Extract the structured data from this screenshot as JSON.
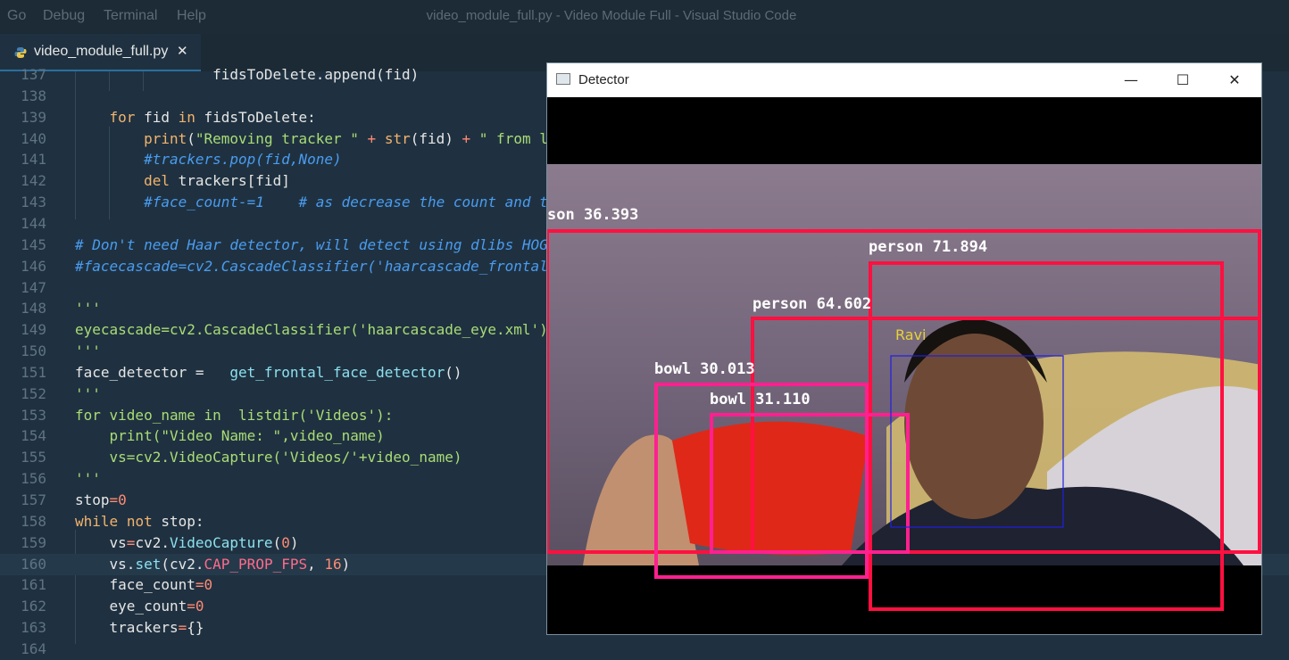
{
  "menu": [
    "Go",
    "Debug",
    "Terminal",
    "Help"
  ],
  "window_title": "video_module_full.py - Video Module Full - Visual Studio Code",
  "tab": {
    "label": "video_module_full.py",
    "close": "✕"
  },
  "code_lines": [
    {
      "n": "137",
      "t": [
        [
          "                fidsToDelete.append(fid)",
          "c-white"
        ]
      ]
    },
    {
      "n": "138",
      "t": []
    },
    {
      "n": "139",
      "t": [
        [
          "    ",
          "c-white"
        ],
        [
          "for",
          "c-kw"
        ],
        [
          " fid ",
          "c-white"
        ],
        [
          "in",
          "c-kw"
        ],
        [
          " fidsToDelete:",
          "c-white"
        ]
      ]
    },
    {
      "n": "140",
      "t": [
        [
          "        ",
          "c-white"
        ],
        [
          "print",
          "c-kw"
        ],
        [
          "(",
          "c-white"
        ],
        [
          "\"Removing tracker \"",
          "c-str"
        ],
        [
          " + ",
          "c-op"
        ],
        [
          "str",
          "c-kw"
        ],
        [
          "(fid) ",
          "c-white"
        ],
        [
          "+",
          "c-op"
        ],
        [
          " \" from l",
          "c-str"
        ]
      ]
    },
    {
      "n": "141",
      "t": [
        [
          "        #trackers.pop(fid,None)",
          "c-com"
        ]
      ]
    },
    {
      "n": "142",
      "t": [
        [
          "        ",
          "c-white"
        ],
        [
          "del",
          "c-kw"
        ],
        [
          " trackers[fid]",
          "c-white"
        ]
      ]
    },
    {
      "n": "143",
      "t": [
        [
          "        #face_count-=1    # as decrease the count and t",
          "c-com"
        ]
      ]
    },
    {
      "n": "144",
      "t": []
    },
    {
      "n": "145",
      "t": [
        [
          "# Don't need Haar detector, will detect using dlibs HOG",
          "c-com"
        ]
      ]
    },
    {
      "n": "146",
      "t": [
        [
          "#facecascade=cv2.CascadeClassifier('haarcascade_frontal",
          "c-com"
        ]
      ]
    },
    {
      "n": "147",
      "t": []
    },
    {
      "n": "148",
      "t": [
        [
          "'''",
          "c-str"
        ]
      ]
    },
    {
      "n": "149",
      "t": [
        [
          "eyecascade=cv2.CascadeClassifier('haarcascade_eye.xml')",
          "c-str"
        ]
      ]
    },
    {
      "n": "150",
      "t": [
        [
          "'''",
          "c-str"
        ]
      ]
    },
    {
      "n": "151",
      "t": [
        [
          "face_detector =   ",
          "c-white"
        ],
        [
          "get_frontal_face_detector",
          "c-fn"
        ],
        [
          "()",
          "c-white"
        ]
      ]
    },
    {
      "n": "152",
      "t": [
        [
          "'''",
          "c-str"
        ]
      ]
    },
    {
      "n": "153",
      "t": [
        [
          "for video_name in  listdir('Videos'):",
          "c-str"
        ]
      ]
    },
    {
      "n": "154",
      "t": [
        [
          "    print(\"Video Name: \",video_name)",
          "c-str"
        ]
      ]
    },
    {
      "n": "155",
      "t": [
        [
          "    vs=cv2.VideoCapture('Videos/'+video_name)",
          "c-str"
        ]
      ]
    },
    {
      "n": "156",
      "t": [
        [
          "'''",
          "c-str"
        ]
      ]
    },
    {
      "n": "157",
      "t": [
        [
          "stop",
          "c-white"
        ],
        [
          "=",
          "c-op"
        ],
        [
          "0",
          "c-num"
        ]
      ]
    },
    {
      "n": "158",
      "t": [
        [
          "while",
          "c-kw"
        ],
        [
          " ",
          "c-white"
        ],
        [
          "not",
          "c-kw"
        ],
        [
          " stop:",
          "c-white"
        ]
      ]
    },
    {
      "n": "159",
      "t": [
        [
          "    vs",
          "c-white"
        ],
        [
          "=",
          "c-op"
        ],
        [
          "cv2.",
          "c-white"
        ],
        [
          "VideoCapture",
          "c-fn"
        ],
        [
          "(",
          "c-white"
        ],
        [
          "0",
          "c-num"
        ],
        [
          ")",
          "c-white"
        ]
      ]
    },
    {
      "n": "160",
      "t": [
        [
          "    vs.",
          "c-white"
        ],
        [
          "set",
          "c-fn"
        ],
        [
          "(cv2.",
          "c-white"
        ],
        [
          "CAP_PROP_FPS",
          "c-pink"
        ],
        [
          ", ",
          "c-white"
        ],
        [
          "16",
          "c-num"
        ],
        [
          ")",
          "c-white"
        ]
      ]
    },
    {
      "n": "161",
      "t": [
        [
          "    face_count",
          "c-white"
        ],
        [
          "=",
          "c-op"
        ],
        [
          "0",
          "c-num"
        ]
      ]
    },
    {
      "n": "162",
      "t": [
        [
          "    eye_count",
          "c-white"
        ],
        [
          "=",
          "c-op"
        ],
        [
          "0",
          "c-num"
        ]
      ]
    },
    {
      "n": "163",
      "t": [
        [
          "    trackers",
          "c-white"
        ],
        [
          "=",
          "c-op"
        ],
        [
          "{}",
          "c-white"
        ]
      ]
    },
    {
      "n": "164",
      "t": []
    }
  ],
  "highlighted_line": "160",
  "detector": {
    "title": "Detector",
    "controls": {
      "minimize": "—",
      "maximize": "☐",
      "close": "✕"
    },
    "labels": {
      "person_a": "son 36.393",
      "person_b": "person 71.894",
      "person_c": "person 64.602",
      "bowl_a": "bowl 30.013",
      "bowl_b": "bowl 31.110",
      "face": "Ravi"
    },
    "colors": {
      "person_box": "#ff1040",
      "bowl_box": "#ff2090",
      "face_box": "#2020e0",
      "face_label": "#e6d238"
    }
  }
}
